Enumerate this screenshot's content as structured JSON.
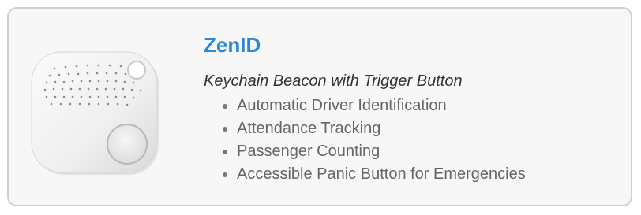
{
  "product": {
    "name": "ZenID",
    "subtitle": "Keychain Beacon with Trigger Button",
    "image": "keychain-beacon-image",
    "features": [
      "Automatic Driver Identification",
      "Attendance Tracking",
      "Passenger Counting",
      "Accessible Panic Button for Emergencies"
    ]
  },
  "colors": {
    "title": "#2b88d8",
    "subtitle": "#333333",
    "feature_text": "#666666",
    "card_background": "#f7f7f7",
    "card_border": "#cfcfcf"
  }
}
